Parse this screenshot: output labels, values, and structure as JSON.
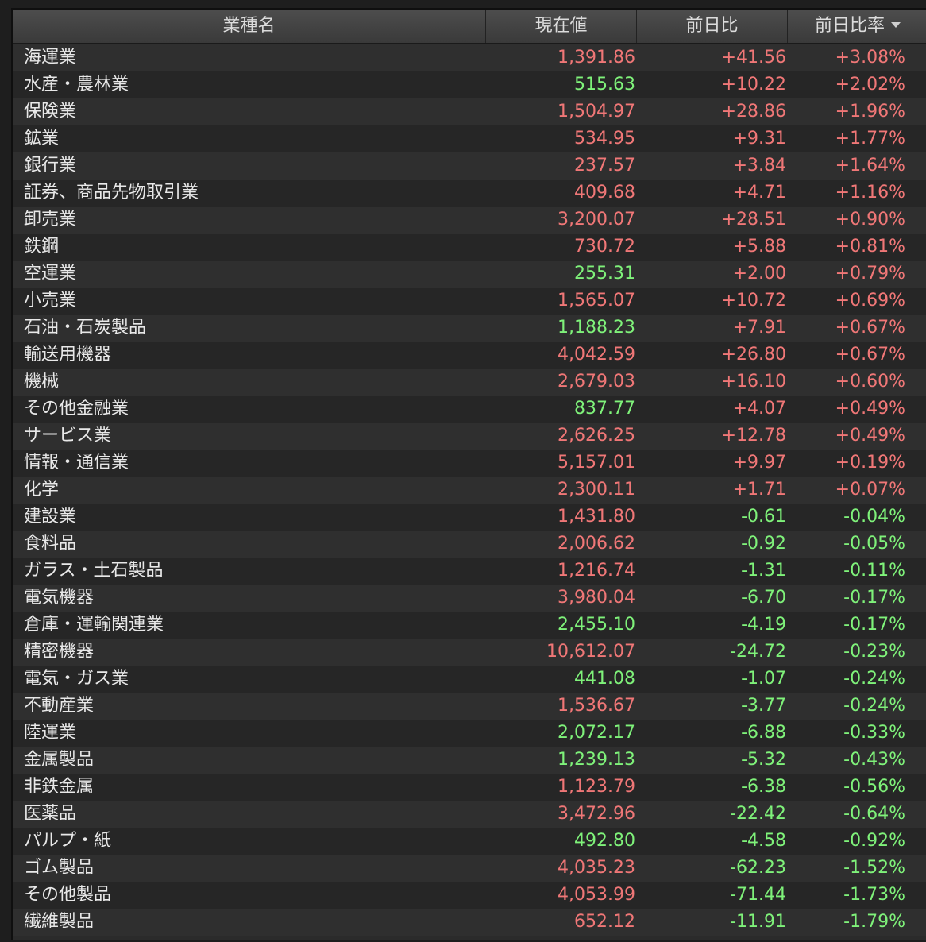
{
  "colors": {
    "up": "#f07777",
    "down": "#7ff27a",
    "header_bg": "#454545"
  },
  "header": {
    "name": "業種名",
    "price": "現在値",
    "change": "前日比",
    "change_pct": "前日比率",
    "sort_icon": "chevron-down-icon"
  },
  "rows": [
    {
      "name": "海運業",
      "price": "1,391.86",
      "price_dir": "up",
      "change": "+41.56",
      "pct": "+3.08%",
      "dir": "up"
    },
    {
      "name": "水産・農林業",
      "price": "515.63",
      "price_dir": "down",
      "change": "+10.22",
      "pct": "+2.02%",
      "dir": "up"
    },
    {
      "name": "保険業",
      "price": "1,504.97",
      "price_dir": "up",
      "change": "+28.86",
      "pct": "+1.96%",
      "dir": "up"
    },
    {
      "name": "鉱業",
      "price": "534.95",
      "price_dir": "up",
      "change": "+9.31",
      "pct": "+1.77%",
      "dir": "up"
    },
    {
      "name": "銀行業",
      "price": "237.57",
      "price_dir": "up",
      "change": "+3.84",
      "pct": "+1.64%",
      "dir": "up"
    },
    {
      "name": "証券、商品先物取引業",
      "price": "409.68",
      "price_dir": "up",
      "change": "+4.71",
      "pct": "+1.16%",
      "dir": "up"
    },
    {
      "name": "卸売業",
      "price": "3,200.07",
      "price_dir": "up",
      "change": "+28.51",
      "pct": "+0.90%",
      "dir": "up"
    },
    {
      "name": "鉄鋼",
      "price": "730.72",
      "price_dir": "up",
      "change": "+5.88",
      "pct": "+0.81%",
      "dir": "up"
    },
    {
      "name": "空運業",
      "price": "255.31",
      "price_dir": "down",
      "change": "+2.00",
      "pct": "+0.79%",
      "dir": "up"
    },
    {
      "name": "小売業",
      "price": "1,565.07",
      "price_dir": "up",
      "change": "+10.72",
      "pct": "+0.69%",
      "dir": "up"
    },
    {
      "name": "石油・石炭製品",
      "price": "1,188.23",
      "price_dir": "down",
      "change": "+7.91",
      "pct": "+0.67%",
      "dir": "up"
    },
    {
      "name": "輸送用機器",
      "price": "4,042.59",
      "price_dir": "up",
      "change": "+26.80",
      "pct": "+0.67%",
      "dir": "up"
    },
    {
      "name": "機械",
      "price": "2,679.03",
      "price_dir": "up",
      "change": "+16.10",
      "pct": "+0.60%",
      "dir": "up"
    },
    {
      "name": "その他金融業",
      "price": "837.77",
      "price_dir": "down",
      "change": "+4.07",
      "pct": "+0.49%",
      "dir": "up"
    },
    {
      "name": "サービス業",
      "price": "2,626.25",
      "price_dir": "up",
      "change": "+12.78",
      "pct": "+0.49%",
      "dir": "up"
    },
    {
      "name": "情報・通信業",
      "price": "5,157.01",
      "price_dir": "up",
      "change": "+9.97",
      "pct": "+0.19%",
      "dir": "up"
    },
    {
      "name": "化学",
      "price": "2,300.11",
      "price_dir": "up",
      "change": "+1.71",
      "pct": "+0.07%",
      "dir": "up"
    },
    {
      "name": "建設業",
      "price": "1,431.80",
      "price_dir": "up",
      "change": "-0.61",
      "pct": "-0.04%",
      "dir": "down"
    },
    {
      "name": "食料品",
      "price": "2,006.62",
      "price_dir": "up",
      "change": "-0.92",
      "pct": "-0.05%",
      "dir": "down"
    },
    {
      "name": "ガラス・土石製品",
      "price": "1,216.74",
      "price_dir": "up",
      "change": "-1.31",
      "pct": "-0.11%",
      "dir": "down"
    },
    {
      "name": "電気機器",
      "price": "3,980.04",
      "price_dir": "up",
      "change": "-6.70",
      "pct": "-0.17%",
      "dir": "down"
    },
    {
      "name": "倉庫・運輸関連業",
      "price": "2,455.10",
      "price_dir": "down",
      "change": "-4.19",
      "pct": "-0.17%",
      "dir": "down"
    },
    {
      "name": "精密機器",
      "price": "10,612.07",
      "price_dir": "up",
      "change": "-24.72",
      "pct": "-0.23%",
      "dir": "down"
    },
    {
      "name": "電気・ガス業",
      "price": "441.08",
      "price_dir": "down",
      "change": "-1.07",
      "pct": "-0.24%",
      "dir": "down"
    },
    {
      "name": "不動産業",
      "price": "1,536.67",
      "price_dir": "up",
      "change": "-3.77",
      "pct": "-0.24%",
      "dir": "down"
    },
    {
      "name": "陸運業",
      "price": "2,072.17",
      "price_dir": "down",
      "change": "-6.88",
      "pct": "-0.33%",
      "dir": "down"
    },
    {
      "name": "金属製品",
      "price": "1,239.13",
      "price_dir": "down",
      "change": "-5.32",
      "pct": "-0.43%",
      "dir": "down"
    },
    {
      "name": "非鉄金属",
      "price": "1,123.79",
      "price_dir": "up",
      "change": "-6.38",
      "pct": "-0.56%",
      "dir": "down"
    },
    {
      "name": "医薬品",
      "price": "3,472.96",
      "price_dir": "up",
      "change": "-22.42",
      "pct": "-0.64%",
      "dir": "down"
    },
    {
      "name": "パルプ・紙",
      "price": "492.80",
      "price_dir": "down",
      "change": "-4.58",
      "pct": "-0.92%",
      "dir": "down"
    },
    {
      "name": "ゴム製品",
      "price": "4,035.23",
      "price_dir": "up",
      "change": "-62.23",
      "pct": "-1.52%",
      "dir": "down"
    },
    {
      "name": "その他製品",
      "price": "4,053.99",
      "price_dir": "up",
      "change": "-71.44",
      "pct": "-1.73%",
      "dir": "down"
    },
    {
      "name": "繊維製品",
      "price": "652.12",
      "price_dir": "up",
      "change": "-11.91",
      "pct": "-1.79%",
      "dir": "down"
    }
  ]
}
